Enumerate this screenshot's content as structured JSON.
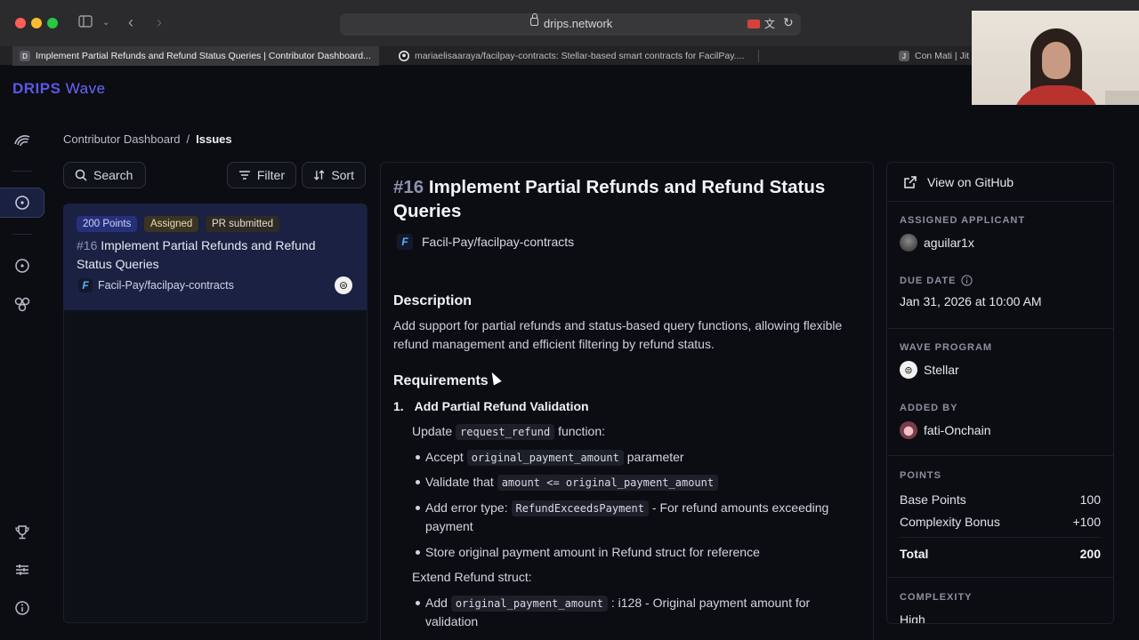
{
  "browser": {
    "url": "drips.network",
    "tabs": [
      {
        "icon": "D",
        "title": "Implement Partial Refunds and Refund Status Queries | Contributor Dashboard..."
      },
      {
        "icon": "gh",
        "title": "mariaelisaaraya/facilpay-contracts: Stellar-based smart contracts for FacilPay...."
      },
      {
        "icon": "J",
        "title": "Con Mati | Jit"
      }
    ]
  },
  "app": {
    "logo_bold": "DRIPS",
    "logo_light": "Wave"
  },
  "breadcrumb": {
    "parent": "Contributor Dashboard",
    "separator": "/",
    "current": "Issues"
  },
  "list_controls": {
    "search_label": "Search",
    "filter_label": "Filter",
    "sort_label": "Sort"
  },
  "issue_card": {
    "points_badge": "200 Points",
    "assigned_badge": "Assigned",
    "pr_badge": "PR submitted",
    "number": "#16",
    "title": "Implement Partial Refunds and Refund Status Queries",
    "repo": "Facil-Pay/facilpay-contracts"
  },
  "issue": {
    "number": "#16",
    "title": "Implement Partial Refunds and Refund Status Queries",
    "repo": "Facil-Pay/facilpay-contracts",
    "description_heading": "Description",
    "description": "Add support for partial refunds and status-based query functions, allowing flexible refund management and efficient filtering by refund status.",
    "requirements_heading": "Requirements",
    "req1_number": "1.",
    "req1_title": "Add Partial Refund Validation",
    "update_pre": "Update",
    "update_code": "request_refund",
    "update_post": "function:",
    "b1_pre": "Accept",
    "b1_code": "original_payment_amount",
    "b1_post": "parameter",
    "b2_pre": "Validate that",
    "b2_code": "amount <= original_payment_amount",
    "b3_pre": "Add error type:",
    "b3_code": "RefundExceedsPayment",
    "b3_post": "- For refund amounts exceeding",
    "b3_cont": "payment",
    "b4": "Store original payment amount in Refund struct for reference",
    "extend": "Extend Refund struct:",
    "b5_pre": "Add",
    "b5_code": "original_payment_amount",
    "b5_post": ": i128 - Original payment amount for",
    "b5_cont": "validation"
  },
  "sidebar": {
    "github_label": "View on GitHub",
    "assigned_label": "ASSIGNED APPLICANT",
    "assigned_value": "aguilar1x",
    "due_label": "DUE DATE",
    "due_value": "Jan 31, 2026 at 10:00 AM",
    "program_label": "WAVE PROGRAM",
    "program_value": "Stellar",
    "added_label": "ADDED BY",
    "added_value": "fati-Onchain",
    "points_label": "POINTS",
    "base_label": "Base Points",
    "base_value": "100",
    "bonus_label": "Complexity Bonus",
    "bonus_value": "+100",
    "total_label": "Total",
    "total_value": "200",
    "complexity_label": "COMPLEXITY",
    "complexity_value": "High"
  },
  "colors": {
    "background": "#0b0d12",
    "selected_card": "#1b2143",
    "brand": "#5b57e6",
    "points_badge": "#26307a"
  }
}
